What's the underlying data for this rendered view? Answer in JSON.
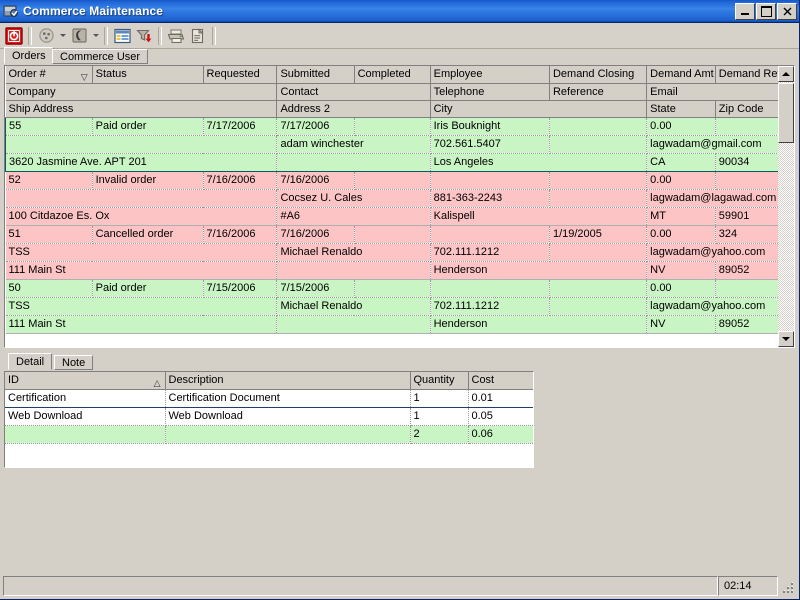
{
  "window": {
    "title": "Commerce Maintenance",
    "icon": "app-icon",
    "minimize_label": "Minimize",
    "maximize_label": "Maximize",
    "close_label": "Close"
  },
  "toolbar": {
    "items": [
      {
        "name": "stop-button",
        "icon": "stop-icon",
        "tooltip": "Stop"
      },
      {
        "name": "refresh-button",
        "icon": "refresh-icon",
        "tooltip": "Refresh"
      },
      {
        "name": "refresh-dropdown",
        "icon": "chevron-down-icon",
        "tooltip": "Refresh options"
      },
      {
        "name": "filter-button",
        "icon": "filter-icon",
        "tooltip": "Filter"
      },
      {
        "name": "filter-dropdown",
        "icon": "chevron-down-icon",
        "tooltip": "Filter options"
      },
      {
        "name": "grid-button",
        "icon": "grid-icon",
        "tooltip": "Grid"
      },
      {
        "name": "export-button",
        "icon": "export-down-icon",
        "tooltip": "Export"
      },
      {
        "name": "print-button",
        "icon": "print-icon",
        "tooltip": "Print"
      },
      {
        "name": "copy-button",
        "icon": "copy-icon",
        "tooltip": "Copy"
      }
    ]
  },
  "tabs": {
    "items": [
      {
        "label": "Orders",
        "active": true
      },
      {
        "label": "Commerce User",
        "active": false
      }
    ]
  },
  "orders_grid": {
    "header_rows": [
      [
        {
          "label": "Order #",
          "sort": "desc"
        },
        {
          "label": "Status"
        },
        {
          "label": "Requested"
        },
        {
          "label": "Submitted"
        },
        {
          "label": "Completed"
        },
        {
          "label": "Employee"
        },
        {
          "label": "Demand Closing"
        },
        {
          "label": "Demand Amt"
        },
        {
          "label": "Demand Ref"
        }
      ],
      [
        {
          "label": "Company"
        },
        {
          "label": "Contact"
        },
        {
          "label": "Telephone"
        },
        {
          "label": "Reference"
        },
        {
          "label": "Email"
        }
      ],
      [
        {
          "label": "Ship Address"
        },
        {
          "label": "Address 2"
        },
        {
          "label": "City"
        },
        {
          "label": "State"
        },
        {
          "label": "Zip Code"
        }
      ]
    ],
    "records": [
      {
        "selected": true,
        "color": "green",
        "order_no": "55",
        "status": "Paid order",
        "requested": "7/17/2006",
        "submitted": "7/17/2006",
        "completed": "",
        "employee": "Iris  Bouknight",
        "demand_closing": "",
        "demand_amt": "0.00",
        "demand_ref": "",
        "company": "",
        "contact": "adam winchester",
        "telephone": "702.561.5407",
        "reference": "",
        "email": "lagwadam@gmail.com",
        "ship_address": "3620 Jasmine Ave. APT 201",
        "address2": "",
        "city": "Los Angeles",
        "state": "CA",
        "zip": "90034"
      },
      {
        "selected": false,
        "color": "pink",
        "order_no": "52",
        "status": "Invalid order",
        "requested": "7/16/2006",
        "submitted": "7/16/2006",
        "completed": "",
        "employee": "",
        "demand_closing": "",
        "demand_amt": "0.00",
        "demand_ref": "",
        "company": "",
        "contact": "Cocsez U. Cales",
        "telephone": "881-363-2243",
        "reference": "",
        "email": "lagwadam@lagawad.com",
        "ship_address": "100 Citdazoe Es. Ox",
        "address2": "#A6",
        "city": "Kalispell",
        "state": "MT",
        "zip": "59901"
      },
      {
        "selected": false,
        "color": "pink",
        "order_no": "51",
        "status": "Cancelled order",
        "requested": "7/16/2006",
        "submitted": "7/16/2006",
        "completed": "",
        "employee": "",
        "demand_closing": "1/19/2005",
        "demand_amt": "0.00",
        "demand_ref": "324",
        "company": "TSS",
        "contact": "Michael Renaldo",
        "telephone": "702.111.1212",
        "reference": "",
        "email": "lagwadam@yahoo.com",
        "ship_address": "111 Main St",
        "address2": "",
        "city": "Henderson",
        "state": "NV",
        "zip": "89052"
      },
      {
        "selected": false,
        "color": "green",
        "order_no": "50",
        "status": "Paid order",
        "requested": "7/15/2006",
        "submitted": "7/15/2006",
        "completed": "",
        "employee": "",
        "demand_closing": "",
        "demand_amt": "0.00",
        "demand_ref": "",
        "company": "TSS",
        "contact": "Michael Renaldo",
        "telephone": "702.111.1212",
        "reference": "",
        "email": "lagwadam@yahoo.com",
        "ship_address": "111 Main St",
        "address2": "",
        "city": "Henderson",
        "state": "NV",
        "zip": "89052"
      }
    ],
    "scrollbar": {
      "up": "scroll-up-arrow",
      "down": "scroll-down-arrow"
    }
  },
  "detail_tabs": {
    "items": [
      {
        "label": "Detail",
        "active": true
      },
      {
        "label": "Note",
        "active": false
      }
    ]
  },
  "detail_grid": {
    "columns": [
      {
        "label": "ID",
        "sort": "asc"
      },
      {
        "label": "Description"
      },
      {
        "label": "Quantity"
      },
      {
        "label": "Cost"
      }
    ],
    "rows": [
      {
        "selected": true,
        "total": false,
        "id": "Certification",
        "description": "Certification Document",
        "quantity": "1",
        "cost": "0.01"
      },
      {
        "selected": false,
        "total": false,
        "id": "Web Download",
        "description": "Web Download",
        "quantity": "1",
        "cost": "0.05"
      },
      {
        "selected": false,
        "total": true,
        "id": "",
        "description": "",
        "quantity": "2",
        "cost": "0.06"
      }
    ]
  },
  "statusbar": {
    "message": "",
    "clock": "02:14",
    "grip": "resize-grip"
  },
  "colors": {
    "row_green": "#c8f5c3",
    "row_pink": "#fcc4c4",
    "chrome": "#d4d0c8",
    "title_blue": "#1d64d6",
    "accent_stop_red": "#d41d1d"
  }
}
